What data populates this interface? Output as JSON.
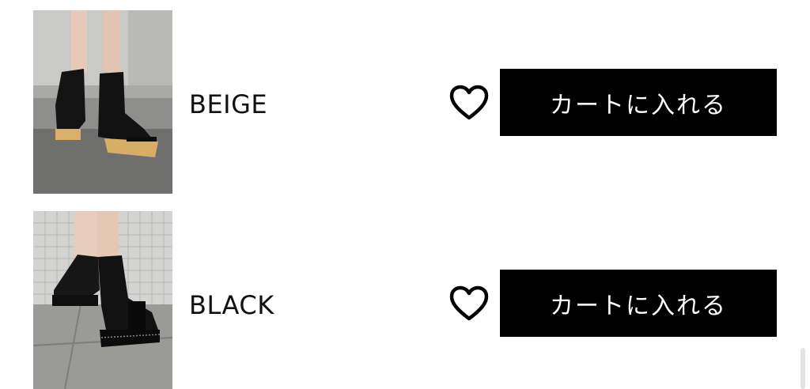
{
  "items": [
    {
      "color_name": "BEIGE",
      "cart_label": "カートに入れる",
      "photo": "beige-platform-boots-photo",
      "favorite_icon": "heart-outline-icon"
    },
    {
      "color_name": "BLACK",
      "cart_label": "カートに入れる",
      "photo": "black-platform-boots-photo",
      "favorite_icon": "heart-outline-icon"
    }
  ],
  "colors": {
    "button_background": "#000000",
    "button_text": "#ffffff",
    "text": "#111111"
  }
}
